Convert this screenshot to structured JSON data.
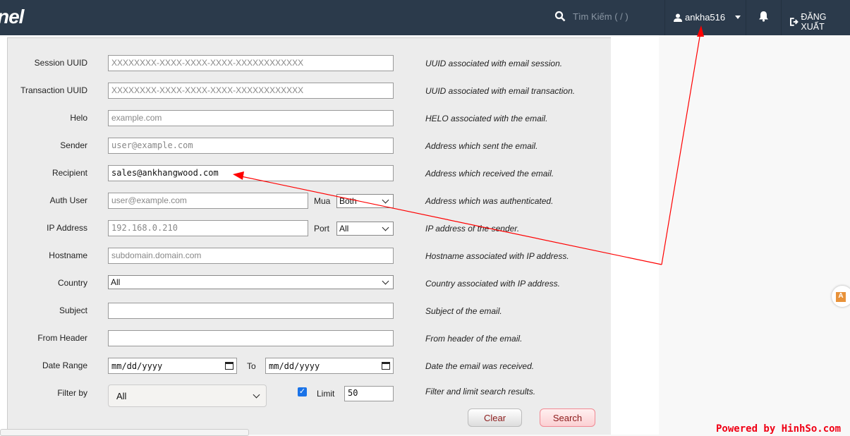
{
  "header": {
    "logo": "nel",
    "search_placeholder": "Tìm Kiếm ( / )",
    "username": "ankha516",
    "logout": "ĐĂNG XUẤT"
  },
  "form": {
    "rows": [
      {
        "label": "Session UUID",
        "placeholder": "XXXXXXXX-XXXX-XXXX-XXXX-XXXXXXXXXXXX",
        "description": "UUID associated with email session."
      },
      {
        "label": "Transaction UUID",
        "placeholder": "XXXXXXXX-XXXX-XXXX-XXXX-XXXXXXXXXXXX",
        "description": "UUID associated with email transaction."
      },
      {
        "label": "Helo",
        "placeholder": "example.com",
        "description": "HELO associated with the email."
      },
      {
        "label": "Sender",
        "placeholder": "user@example.com",
        "description": "Address which sent the email."
      },
      {
        "label": "Recipient",
        "value": "sales@ankhangwood.com",
        "description": "Address which received the email."
      },
      {
        "label": "Auth User",
        "placeholder": "user@example.com",
        "extra_label": "Mua",
        "extra_value": "Both",
        "description": "Address which was authenticated."
      },
      {
        "label": "IP Address",
        "placeholder": "192.168.0.210",
        "extra_label": "Port",
        "extra_value": "All",
        "description": "IP address of the sender."
      },
      {
        "label": "Hostname",
        "placeholder": "subdomain.domain.com",
        "description": "Hostname associated with IP address."
      },
      {
        "label": "Country",
        "value": "All",
        "description": "Country associated with IP address."
      },
      {
        "label": "Subject",
        "value": "",
        "description": "Subject of the email."
      },
      {
        "label": "From Header",
        "value": "",
        "description": "From header of the email."
      },
      {
        "label": "Date Range",
        "from": "mm/dd/yyyy",
        "to_label": "To",
        "to": "mm/dd/yyyy",
        "description": "Date the email was received."
      },
      {
        "label": "Filter by",
        "value": "All",
        "limit_label": "Limit",
        "limit": "50",
        "limit_checked": true,
        "description": "Filter and limit search results."
      }
    ],
    "clear": "Clear",
    "search": "Search"
  },
  "watermark": "Powered by HinhSo.com",
  "colors": {
    "header": "#2b3a4b",
    "annotation": "#ff0000"
  }
}
